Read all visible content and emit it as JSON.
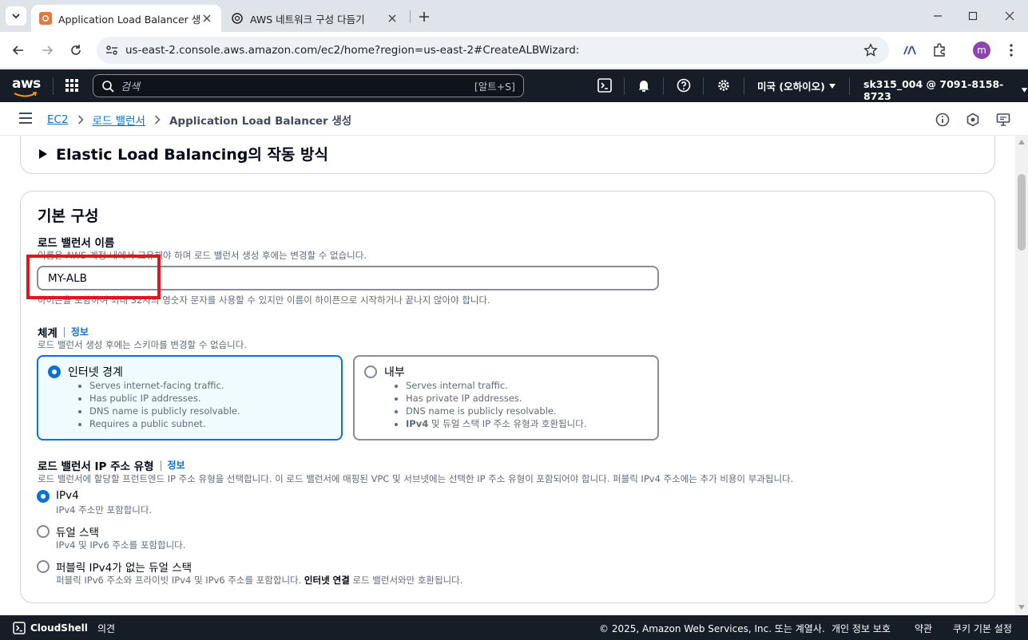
{
  "browser": {
    "tabs": [
      {
        "title": "Application Load Balancer 생성",
        "active": true
      },
      {
        "title": "AWS 네트워크 구성 다듬기",
        "active": false
      }
    ],
    "url": "us-east-2.console.aws.amazon.com/ec2/home?region=us-east-2#CreateALBWizard:",
    "profile_initial": "m"
  },
  "aws_nav": {
    "logo": "aws",
    "search_placeholder": "검색",
    "search_shortcut": "[알트+S]",
    "region": "미국 (오하이오)",
    "account": "sk315_004 @ 7091-8158-8723"
  },
  "breadcrumb": {
    "items": [
      "EC2",
      "로드 밸런서"
    ],
    "current": "Application Load Balancer 생성"
  },
  "how_it_works": {
    "title": "Elastic Load Balancing의 작동 방식"
  },
  "basic_config": {
    "title": "기본 구성",
    "name_field": {
      "label": "로드 밸런서 이름",
      "description": "이름은 AWS 계정 내에서 고유해야 하며 로드 밸런서 생성 후에는 변경할 수 없습니다.",
      "value": "MY-ALB",
      "constraint": "하이픈을 포함하여 최대 32자의 영숫자 문자를 사용할 수 있지만 이름이 하이픈으로 시작하거나 끝나지 않아야 합니다."
    },
    "scheme": {
      "label": "체계",
      "info": "정보",
      "description": "로드 밸런서 생성 후에는 스키마를 변경할 수 없습니다.",
      "options": [
        {
          "label": "인터넷 경계",
          "selected": true,
          "bullets": [
            "Serves internet-facing traffic.",
            "Has public IP addresses.",
            "DNS name is publicly resolvable.",
            "Requires a public subnet."
          ]
        },
        {
          "label": "내부",
          "selected": false,
          "bullets": [
            "Serves internal traffic.",
            "Has private IP addresses.",
            "DNS name is publicly resolvable."
          ],
          "last_bullet_bold": "IPv4",
          "last_bullet_rest": " 및 듀얼 스택 IP 주소 유형과 호환됩니다."
        }
      ]
    },
    "ip_type": {
      "label": "로드 밸런서 IP 주소 유형",
      "info": "정보",
      "description": "로드 밸런서에 할당할 프런트엔드 IP 주소 유형을 선택합니다. 이 로드 밸런서에 매핑된 VPC 및 서브넷에는 선택한 IP 주소 유형이 포함되어야 합니다. 퍼블릭 IPv4 주소에는 추가 비용이 부과됩니다.",
      "options": [
        {
          "label": "IPv4",
          "desc": "IPv4 주소만 포함합니다.",
          "selected": true
        },
        {
          "label": "듀얼 스택",
          "desc": "IPv4 및 IPv6 주소를 포함합니다.",
          "selected": false
        },
        {
          "label": "퍼블릭 IPv4가 없는 듀얼 스택",
          "desc_a": "퍼블릭 IPv6 주소와 프라이빗 IPv4 및 IPv6 주소를 포함합니다. ",
          "desc_bold": "인터넷 연결",
          "desc_b": " 로드 밸런서와만 호환됩니다.",
          "selected": false
        }
      ]
    }
  },
  "footer": {
    "cloudshell": "CloudShell",
    "feedback": "의견",
    "copyright": "© 2025, Amazon Web Services, Inc. 또는 계열사.",
    "privacy": "개인 정보 보호",
    "terms": "약관",
    "cookies": "쿠키 기본 설정"
  }
}
